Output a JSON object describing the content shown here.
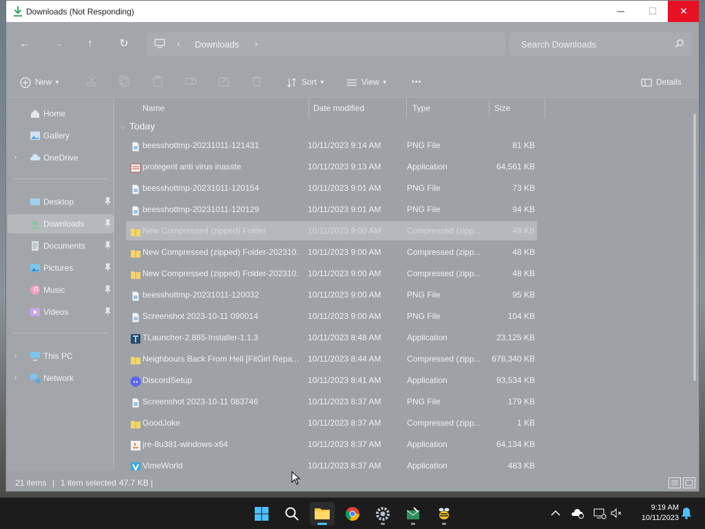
{
  "window": {
    "title": "Downloads (Not Responding)"
  },
  "controls": {
    "minimize": "─",
    "maximize": "☐",
    "close": "✕"
  },
  "nav": {
    "back": "←",
    "forward": "→",
    "up": "↑",
    "refresh": "↻",
    "breadcrumb_sep": "›",
    "breadcrumb": "Downloads",
    "search_placeholder": "Search Downloads"
  },
  "commands": {
    "new": "New",
    "sort": "Sort",
    "view": "View",
    "more": "•••",
    "details": "Details"
  },
  "sidebar": {
    "items": [
      {
        "label": "Home",
        "icon": "home-icon"
      },
      {
        "label": "Gallery",
        "icon": "gallery-icon"
      },
      {
        "label": "OneDrive",
        "icon": "cloud-icon"
      },
      {
        "label": "Desktop",
        "icon": "desktop-icon"
      },
      {
        "label": "Downloads",
        "icon": "download-icon"
      },
      {
        "label": "Documents",
        "icon": "documents-icon"
      },
      {
        "label": "Pictures",
        "icon": "pictures-icon"
      },
      {
        "label": "Music",
        "icon": "music-icon"
      },
      {
        "label": "Videos",
        "icon": "videos-icon"
      },
      {
        "label": "This PC",
        "icon": "pc-icon"
      },
      {
        "label": "Network",
        "icon": "network-icon"
      }
    ]
  },
  "columns": {
    "name": "Name",
    "date": "Date modified",
    "type": "Type",
    "size": "Size"
  },
  "group": {
    "label": "Today"
  },
  "files": [
    {
      "name": "beesshottmp-20231011-121431",
      "date": "10/11/2023 9:14 AM",
      "type": "PNG File",
      "size": "81 KB",
      "icon": "png-file-icon"
    },
    {
      "name": "protegent anti virus inasste",
      "date": "10/11/2023 9:13 AM",
      "type": "Application",
      "size": "64,561 KB",
      "icon": "application-icon"
    },
    {
      "name": "beesshottmp-20231011-120154",
      "date": "10/11/2023 9:01 AM",
      "type": "PNG File",
      "size": "73 KB",
      "icon": "png-file-icon"
    },
    {
      "name": "beesshottmp-20231011-120129",
      "date": "10/11/2023 9:01 AM",
      "type": "PNG File",
      "size": "94 KB",
      "icon": "png-file-icon"
    },
    {
      "name": "New Compressed (zipped) Folder",
      "date": "10/11/2023 9:00 AM",
      "type": "Compressed (zipp...",
      "size": "48 KB",
      "icon": "zip-folder-icon"
    },
    {
      "name": "New Compressed (zipped) Folder-202310...",
      "date": "10/11/2023 9:00 AM",
      "type": "Compressed (zipp...",
      "size": "48 KB",
      "icon": "zip-folder-icon"
    },
    {
      "name": "New Compressed (zipped) Folder-202310...",
      "date": "10/11/2023 9:00 AM",
      "type": "Compressed (zipp...",
      "size": "48 KB",
      "icon": "zip-folder-icon"
    },
    {
      "name": "beesshottmp-20231011-120032",
      "date": "10/11/2023 9:00 AM",
      "type": "PNG File",
      "size": "95 KB",
      "icon": "png-file-icon"
    },
    {
      "name": "Screenshot 2023-10-11 090014",
      "date": "10/11/2023 9:00 AM",
      "type": "PNG File",
      "size": "104 KB",
      "icon": "png-file-icon"
    },
    {
      "name": "TLauncher-2.885-Installer-1.1.3",
      "date": "10/11/2023 8:48 AM",
      "type": "Application",
      "size": "23,125 KB",
      "icon": "tlauncher-icon"
    },
    {
      "name": "Neighbours Back From Hell [FitGirl Repa...",
      "date": "10/11/2023 8:44 AM",
      "type": "Compressed (zipp...",
      "size": "678,340 KB",
      "icon": "zip-folder-icon"
    },
    {
      "name": "DiscordSetup",
      "date": "10/11/2023 8:41 AM",
      "type": "Application",
      "size": "93,534 KB",
      "icon": "discord-icon"
    },
    {
      "name": "Screenshot 2023-10-11 083746",
      "date": "10/11/2023 8:37 AM",
      "type": "PNG File",
      "size": "179 KB",
      "icon": "png-file-icon"
    },
    {
      "name": "GoodJoke",
      "date": "10/11/2023 8:37 AM",
      "type": "Compressed (zipp...",
      "size": "1 KB",
      "icon": "zip-folder-icon"
    },
    {
      "name": "jre-8u381-windows-x64",
      "date": "10/11/2023 8:37 AM",
      "type": "Application",
      "size": "64,134 KB",
      "icon": "java-icon"
    },
    {
      "name": "VimeWorld",
      "date": "10/11/2023 8:37 AM",
      "type": "Application",
      "size": "483 KB",
      "icon": "vimeworld-icon"
    }
  ],
  "selected_index": 4,
  "status": {
    "items": "21 items",
    "selected": "1 item selected",
    "size": "47.7 KB",
    "sep": "|"
  },
  "taskbar": {
    "time": "9:19 AM",
    "date": "10/11/2023",
    "apps": [
      "start-icon",
      "search-icon",
      "file-explorer-icon",
      "chrome-icon",
      "settings-icon",
      "mail-app-icon",
      "bee-app-icon"
    ]
  },
  "colors": {
    "accent": "#4cc2ff",
    "close_button": "#e81123",
    "taskbar": "#1c1c1c"
  }
}
